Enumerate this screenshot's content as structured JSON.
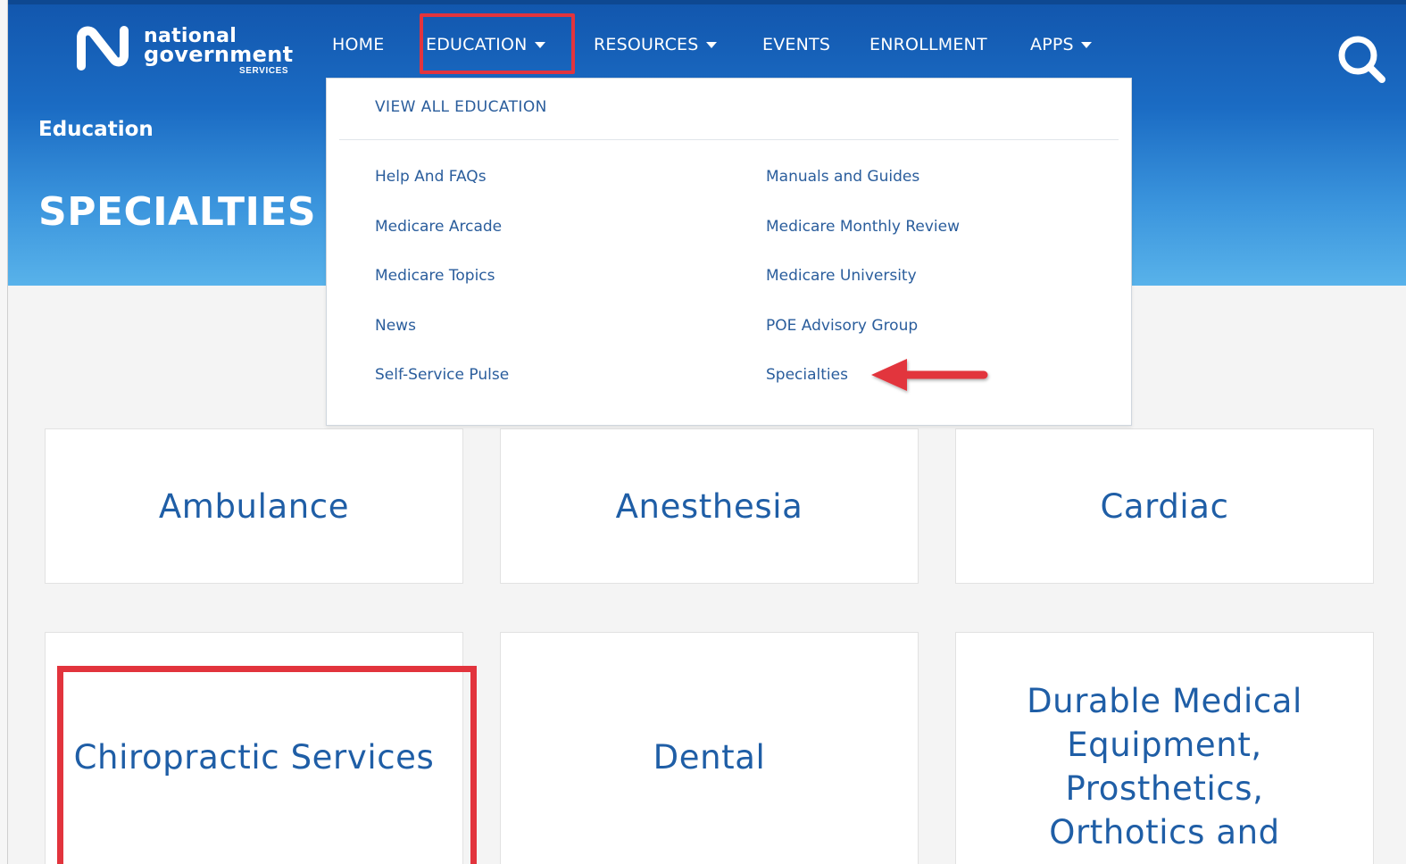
{
  "header": {
    "logo": {
      "line1": "national",
      "line2": "government",
      "line3": "SERVICES"
    },
    "nav": [
      {
        "label": "HOME",
        "has_dropdown": false
      },
      {
        "label": "EDUCATION",
        "has_dropdown": true,
        "active": true
      },
      {
        "label": "RESOURCES",
        "has_dropdown": true
      },
      {
        "label": "EVENTS",
        "has_dropdown": false
      },
      {
        "label": "ENROLLMENT",
        "has_dropdown": false
      },
      {
        "label": "APPS",
        "has_dropdown": true
      }
    ],
    "search_icon": "search-icon"
  },
  "hero": {
    "breadcrumb": "Education",
    "title": "SPECIALTIES"
  },
  "dropdown": {
    "view_all": "VIEW ALL EDUCATION",
    "left_links": [
      "Help And FAQs",
      "Medicare Arcade",
      "Medicare Topics",
      "News",
      "Self-Service Pulse"
    ],
    "right_links": [
      "Manuals and Guides",
      "Medicare Monthly Review",
      "Medicare University",
      "POE Advisory Group",
      "Specialties"
    ]
  },
  "cards": [
    "Ambulance",
    "Anesthesia",
    "Cardiac",
    "Chiropractic Services",
    "Dental",
    "Durable Medical Equipment, Prosthetics, Orthotics and"
  ],
  "colors": {
    "brand_blue": "#1b6cc4",
    "link_blue": "#2a5d9c",
    "card_text": "#1f5ea6",
    "annotation_red": "#e2343d"
  }
}
